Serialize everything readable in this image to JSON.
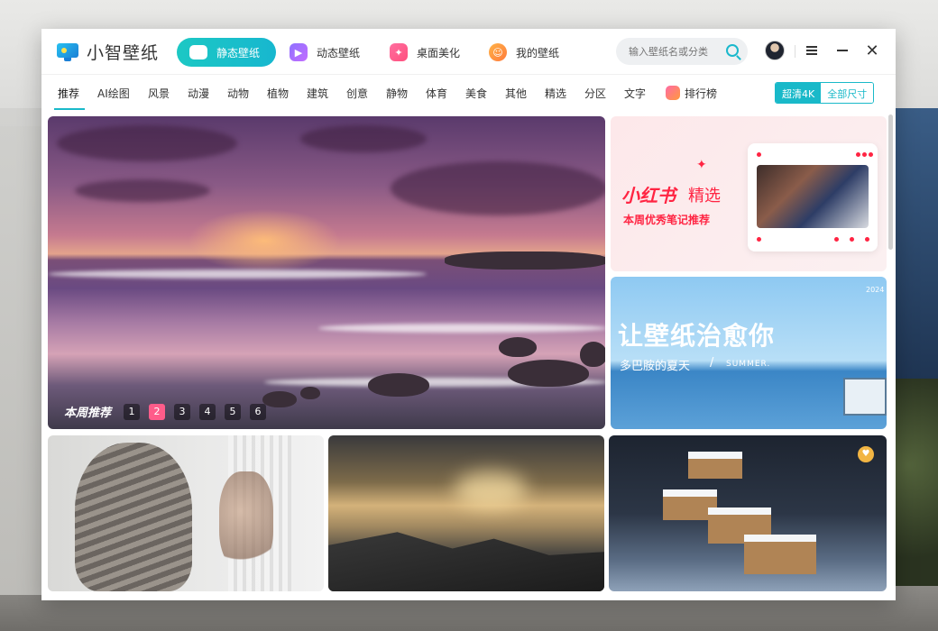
{
  "app": {
    "name": "小智壁纸"
  },
  "main_tabs": [
    {
      "label": "静态壁纸",
      "active": true
    },
    {
      "label": "动态壁纸",
      "active": false
    },
    {
      "label": "桌面美化",
      "active": false
    },
    {
      "label": "我的壁纸",
      "active": false
    }
  ],
  "search": {
    "placeholder": "输入壁纸名或分类"
  },
  "categories": [
    "推荐",
    "AI绘图",
    "风景",
    "动漫",
    "动物",
    "植物",
    "建筑",
    "创意",
    "静物",
    "体育",
    "美食",
    "其他",
    "精选",
    "分区",
    "文字",
    "排行榜"
  ],
  "active_category": "推荐",
  "resolution": {
    "uhd": "超清4K",
    "all": "全部尺寸"
  },
  "hero": {
    "label": "本周推荐",
    "pages": [
      "1",
      "2",
      "3",
      "4",
      "5",
      "6"
    ],
    "current_page": "2"
  },
  "banner_xhs": {
    "brand": "小红书",
    "select": "精选",
    "subtitle": "本周优秀笔记推荐"
  },
  "banner_heal": {
    "title": "让壁纸治愈你",
    "subtitle": "多巴胺的夏天",
    "slash": "/",
    "en": "SUMMER.",
    "year": "2024"
  },
  "colors": {
    "accent": "#19b9c9",
    "page_active": "#ff5c8a",
    "xhs_red": "#ff2442"
  }
}
